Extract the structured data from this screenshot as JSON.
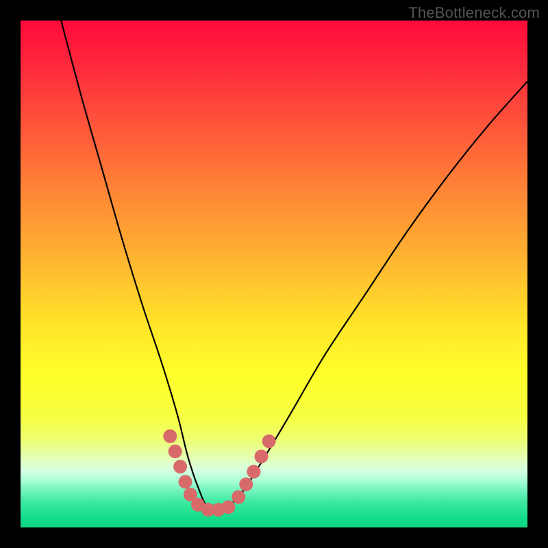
{
  "watermark": "TheBottleneck.com",
  "chart_data": {
    "type": "line",
    "title": "",
    "xlabel": "",
    "ylabel": "",
    "xlim": [
      0,
      100
    ],
    "ylim": [
      0,
      100
    ],
    "grid": false,
    "legend": false,
    "annotations": [],
    "series": [
      {
        "name": "curve",
        "x": [
          8,
          12,
          16,
          20,
          24,
          28,
          31,
          33,
          35,
          37,
          40,
          43,
          47,
          53,
          60,
          68,
          76,
          84,
          92,
          100
        ],
        "y": [
          100,
          85,
          71,
          57,
          44,
          32,
          22,
          14,
          8,
          4,
          4,
          6,
          12,
          22,
          34,
          46,
          58,
          69,
          79,
          88
        ]
      }
    ],
    "markers": [
      {
        "x": 29.5,
        "y": 18
      },
      {
        "x": 30.5,
        "y": 15
      },
      {
        "x": 31.5,
        "y": 12
      },
      {
        "x": 32.5,
        "y": 9
      },
      {
        "x": 33.5,
        "y": 6.5
      },
      {
        "x": 35.0,
        "y": 4.5
      },
      {
        "x": 37.0,
        "y": 3.5
      },
      {
        "x": 39.0,
        "y": 3.5
      },
      {
        "x": 41.0,
        "y": 4.0
      },
      {
        "x": 43.0,
        "y": 6.0
      },
      {
        "x": 44.5,
        "y": 8.5
      },
      {
        "x": 46.0,
        "y": 11.0
      },
      {
        "x": 47.5,
        "y": 14.0
      },
      {
        "x": 49.0,
        "y": 17.0
      }
    ],
    "gradient_stops": [
      {
        "offset": 0.0,
        "color": "#ff0a3a"
      },
      {
        "offset": 0.1,
        "color": "#ff2d3d"
      },
      {
        "offset": 0.22,
        "color": "#ff5a3a"
      },
      {
        "offset": 0.35,
        "color": "#ff8a35"
      },
      {
        "offset": 0.48,
        "color": "#ffb830"
      },
      {
        "offset": 0.6,
        "color": "#ffe529"
      },
      {
        "offset": 0.7,
        "color": "#ffff2a"
      },
      {
        "offset": 0.78,
        "color": "#f7ff40"
      },
      {
        "offset": 0.825,
        "color": "#eeff70"
      },
      {
        "offset": 0.86,
        "color": "#e5ffb0"
      },
      {
        "offset": 0.885,
        "color": "#d8ffe0"
      },
      {
        "offset": 0.905,
        "color": "#b0ffd8"
      },
      {
        "offset": 0.925,
        "color": "#78f5c0"
      },
      {
        "offset": 0.95,
        "color": "#3de9a0"
      },
      {
        "offset": 0.98,
        "color": "#15dd8a"
      },
      {
        "offset": 1.0,
        "color": "#0fd683"
      }
    ],
    "marker_color": "#d86a6a",
    "curve_color": "#000000",
    "curve_width": 2.2,
    "marker_radius": 10
  }
}
